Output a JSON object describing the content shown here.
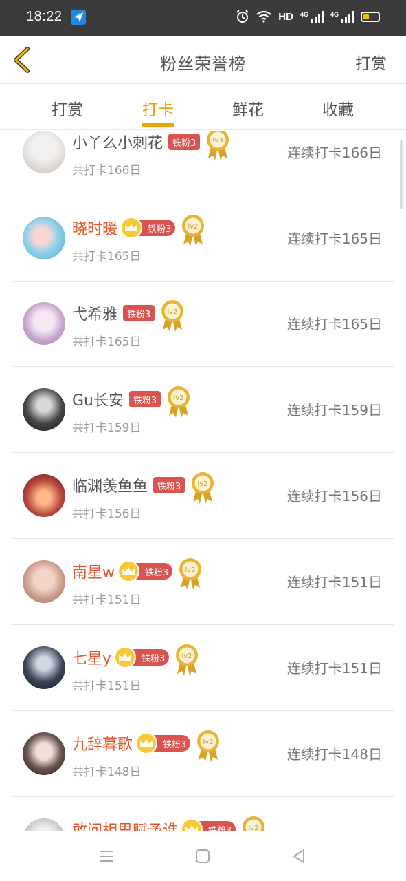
{
  "status_bar": {
    "time": "18:22",
    "hd": "HD",
    "net1": "4G",
    "net2": "4G"
  },
  "header": {
    "title": "粉丝荣誉榜",
    "right_action": "打赏"
  },
  "tabs": [
    {
      "label": "打赏",
      "active": false
    },
    {
      "label": "打卡",
      "active": true
    },
    {
      "label": "鲜花",
      "active": false
    },
    {
      "label": "收藏",
      "active": false
    }
  ],
  "rows": [
    {
      "name": "小丫么小刺花",
      "vip": false,
      "badge": "铁粉3",
      "level": "lv3",
      "total": "共打卡166日",
      "streak": "连续打卡166日"
    },
    {
      "name": "晓时暖",
      "vip": true,
      "badge": "铁粉3",
      "level": "lv2",
      "total": "共打卡165日",
      "streak": "连续打卡165日"
    },
    {
      "name": "弋希雅",
      "vip": false,
      "badge": "铁粉3",
      "level": "lv2",
      "total": "共打卡165日",
      "streak": "连续打卡165日"
    },
    {
      "name": "Gu长安",
      "vip": false,
      "badge": "铁粉3",
      "level": "lv2",
      "total": "共打卡159日",
      "streak": "连续打卡159日"
    },
    {
      "name": "临渊羡鱼鱼",
      "vip": false,
      "badge": "铁粉3",
      "level": "lv2",
      "total": "共打卡156日",
      "streak": "连续打卡156日"
    },
    {
      "name": "南星w",
      "vip": true,
      "badge": "铁粉3",
      "level": "lv2",
      "total": "共打卡151日",
      "streak": "连续打卡151日"
    },
    {
      "name": "七星y",
      "vip": true,
      "badge": "铁粉3",
      "level": "lv2",
      "total": "共打卡151日",
      "streak": "连续打卡151日"
    },
    {
      "name": "九辞暮歌",
      "vip": true,
      "badge": "铁粉3",
      "level": "lv2",
      "total": "共打卡148日",
      "streak": "连续打卡148日"
    },
    {
      "name": "敢问相思赋予谁",
      "vip": true,
      "badge": "铁粉3",
      "level": "lv2",
      "total": "",
      "streak": ""
    }
  ],
  "colors": {
    "accent": "#f0a000",
    "vip_name": "#e4572e",
    "badge": "#d9534f",
    "medal": "#e9b431"
  }
}
